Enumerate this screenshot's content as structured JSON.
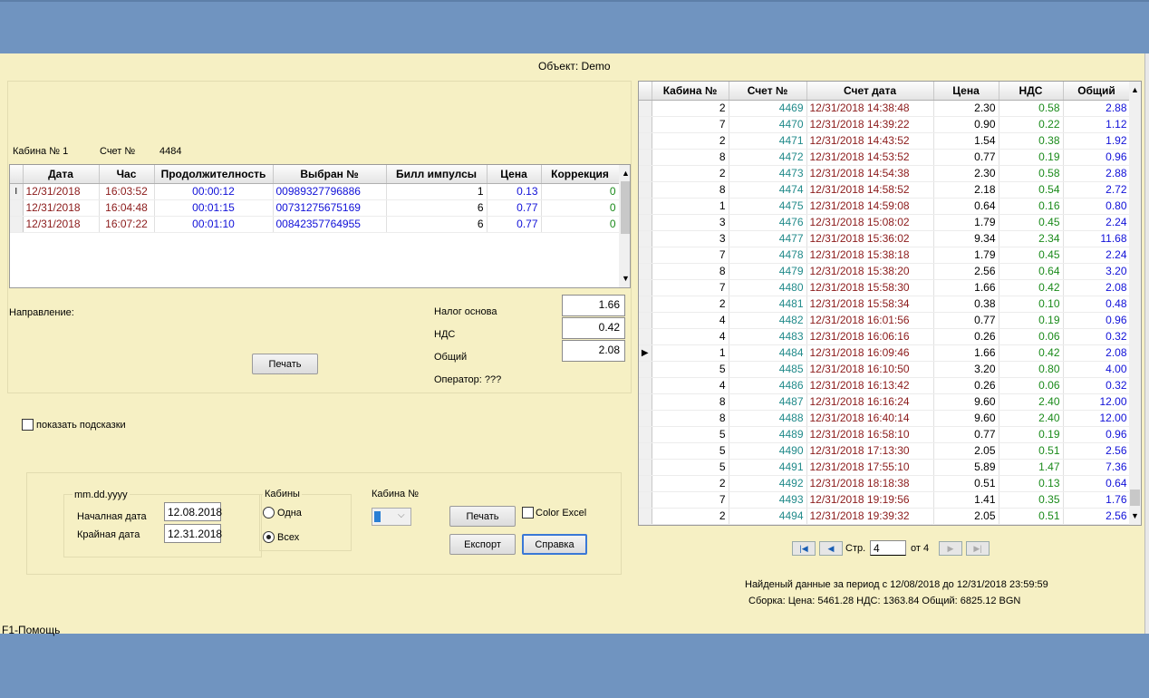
{
  "object_label": "Объект: Demo",
  "cabin_info": {
    "cabin": "Кабина № 1",
    "bill_label": "Счет №",
    "bill_no": "4484"
  },
  "calls": {
    "columns": [
      "Дата",
      "Час",
      "Продолжителность",
      "Выбран №",
      "Билл импулсы",
      "Цена",
      "Коррекция"
    ],
    "rows": [
      [
        "12/31/2018",
        "16:03:52",
        "00:00:12",
        "00989327796886",
        "1",
        "0.13",
        "0"
      ],
      [
        "12/31/2018",
        "16:04:48",
        "00:01:15",
        "00731275675169",
        "6",
        "0.77",
        "0"
      ],
      [
        "12/31/2018",
        "16:07:22",
        "00:01:10",
        "00842357764955",
        "6",
        "0.77",
        "0"
      ]
    ]
  },
  "direction_label": "Направление:",
  "totals": {
    "tax_base_label": "Налог основа",
    "tax_base": "1.66",
    "vat_label": "НДС",
    "vat": "0.42",
    "total_label": "Общий",
    "total": "2.08",
    "operator": "Оператор: ???"
  },
  "print_label": "Печать",
  "show_hints": "показать подсказки",
  "filter": {
    "date_format": "mm.dd.yyyy",
    "start_label": "Началная дата",
    "start_value": "12.08.2018",
    "end_label": "Крайная дата",
    "end_value": "12.31.2018",
    "cabins_label": "Кабины",
    "one_label": "Одна",
    "all_label": "Всех",
    "cabin_no_label": "Кабина №",
    "print_label": "Печать",
    "color_excel": "Color Excel",
    "export_label": "Експорт",
    "help_label": "Справка"
  },
  "bills": {
    "columns": [
      "Кабина №",
      "Счет №",
      "Счет дата",
      "Цена",
      "НДС",
      "Общий"
    ],
    "current_row": 15,
    "rows": [
      [
        "2",
        "4469",
        "12/31/2018 14:38:48",
        "2.30",
        "0.58",
        "2.88"
      ],
      [
        "7",
        "4470",
        "12/31/2018 14:39:22",
        "0.90",
        "0.22",
        "1.12"
      ],
      [
        "2",
        "4471",
        "12/31/2018 14:43:52",
        "1.54",
        "0.38",
        "1.92"
      ],
      [
        "8",
        "4472",
        "12/31/2018 14:53:52",
        "0.77",
        "0.19",
        "0.96"
      ],
      [
        "2",
        "4473",
        "12/31/2018 14:54:38",
        "2.30",
        "0.58",
        "2.88"
      ],
      [
        "8",
        "4474",
        "12/31/2018 14:58:52",
        "2.18",
        "0.54",
        "2.72"
      ],
      [
        "1",
        "4475",
        "12/31/2018 14:59:08",
        "0.64",
        "0.16",
        "0.80"
      ],
      [
        "3",
        "4476",
        "12/31/2018 15:08:02",
        "1.79",
        "0.45",
        "2.24"
      ],
      [
        "3",
        "4477",
        "12/31/2018 15:36:02",
        "9.34",
        "2.34",
        "11.68"
      ],
      [
        "7",
        "4478",
        "12/31/2018 15:38:18",
        "1.79",
        "0.45",
        "2.24"
      ],
      [
        "8",
        "4479",
        "12/31/2018 15:38:20",
        "2.56",
        "0.64",
        "3.20"
      ],
      [
        "7",
        "4480",
        "12/31/2018 15:58:30",
        "1.66",
        "0.42",
        "2.08"
      ],
      [
        "2",
        "4481",
        "12/31/2018 15:58:34",
        "0.38",
        "0.10",
        "0.48"
      ],
      [
        "4",
        "4482",
        "12/31/2018 16:01:56",
        "0.77",
        "0.19",
        "0.96"
      ],
      [
        "4",
        "4483",
        "12/31/2018 16:06:16",
        "0.26",
        "0.06",
        "0.32"
      ],
      [
        "1",
        "4484",
        "12/31/2018 16:09:46",
        "1.66",
        "0.42",
        "2.08"
      ],
      [
        "5",
        "4485",
        "12/31/2018 16:10:50",
        "3.20",
        "0.80",
        "4.00"
      ],
      [
        "4",
        "4486",
        "12/31/2018 16:13:42",
        "0.26",
        "0.06",
        "0.32"
      ],
      [
        "8",
        "4487",
        "12/31/2018 16:16:24",
        "9.60",
        "2.40",
        "12.00"
      ],
      [
        "8",
        "4488",
        "12/31/2018 16:40:14",
        "9.60",
        "2.40",
        "12.00"
      ],
      [
        "5",
        "4489",
        "12/31/2018 16:58:10",
        "0.77",
        "0.19",
        "0.96"
      ],
      [
        "5",
        "4490",
        "12/31/2018 17:13:30",
        "2.05",
        "0.51",
        "2.56"
      ],
      [
        "5",
        "4491",
        "12/31/2018 17:55:10",
        "5.89",
        "1.47",
        "7.36"
      ],
      [
        "2",
        "4492",
        "12/31/2018 18:18:38",
        "0.51",
        "0.13",
        "0.64"
      ],
      [
        "7",
        "4493",
        "12/31/2018 19:19:56",
        "1.41",
        "0.35",
        "1.76"
      ],
      [
        "2",
        "4494",
        "12/31/2018 19:39:32",
        "2.05",
        "0.51",
        "2.56"
      ]
    ]
  },
  "pager": {
    "page_label": "Стр.",
    "page": "4",
    "of_label": "от 4"
  },
  "summary": {
    "found": "Найденый данные за период с 12/08/2018  до 12/31/2018 23:59:59",
    "totals": "Сборка:  Цена: 5461.28  НДС: 1363.84  Общий: 6825.12 BGN"
  },
  "status_bar": "F1-Помощь",
  "colors": {
    "background": "#f6f0c4",
    "frame": "#7094c0",
    "date": "#8b1a1a",
    "number": "#1010d8",
    "bill": "#208a8a",
    "vat": "#1a8a1a"
  }
}
